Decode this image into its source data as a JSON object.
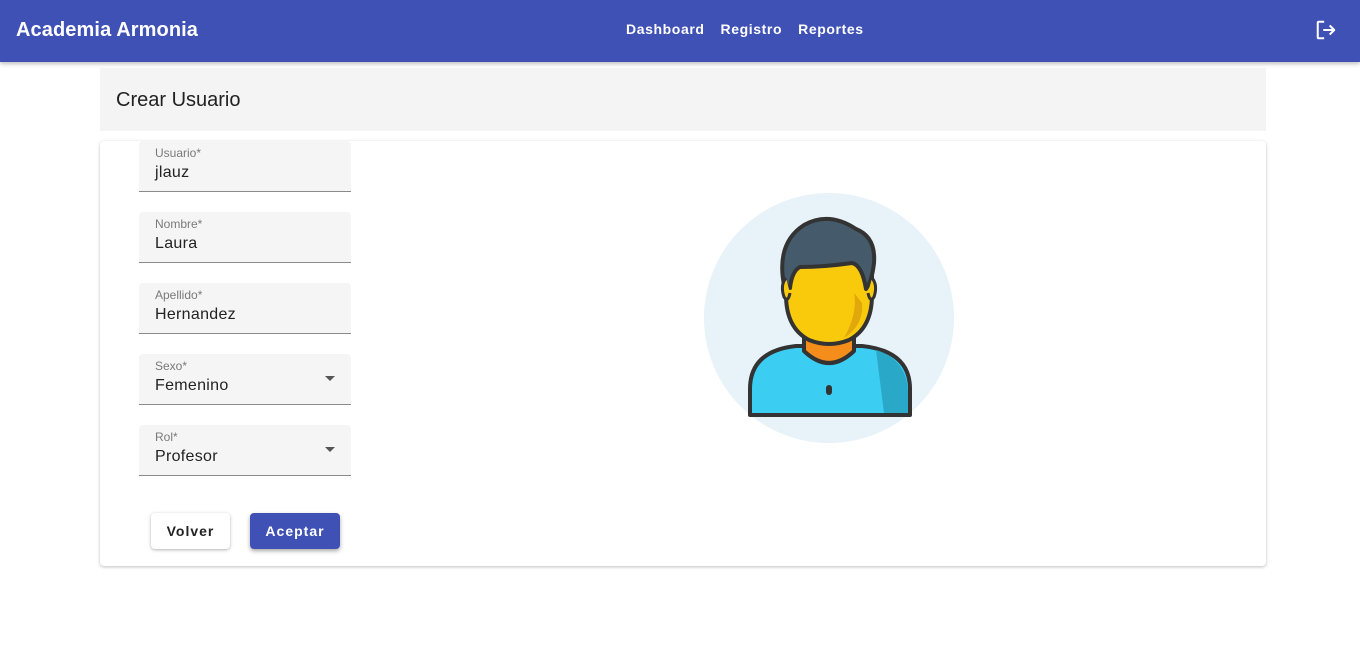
{
  "app": {
    "title": "Academia Armonia"
  },
  "nav": {
    "items": [
      {
        "label": "Dashboard"
      },
      {
        "label": "Registro"
      },
      {
        "label": "Reportes"
      }
    ],
    "logout_icon": "logout-icon"
  },
  "page": {
    "title": "Crear Usuario"
  },
  "form": {
    "usuario": {
      "label": "Usuario*",
      "value": "jlauz"
    },
    "nombre": {
      "label": "Nombre*",
      "value": "Laura"
    },
    "apellido": {
      "label": "Apellido*",
      "value": "Hernandez"
    },
    "sexo": {
      "label": "Sexo*",
      "value": "Femenino"
    },
    "rol": {
      "label": "Rol*",
      "value": "Profesor"
    }
  },
  "buttons": {
    "back_label": "Volver",
    "accept_label": "Aceptar"
  },
  "colors": {
    "primary": "#3f51b5",
    "avatar_bg": "#e8f2f9",
    "shirt": "#3ccdf2",
    "skin": "#f9c90c",
    "hair": "#455a6a",
    "neck": "#f58d1a"
  },
  "avatar": {
    "icon": "user-avatar-icon"
  }
}
